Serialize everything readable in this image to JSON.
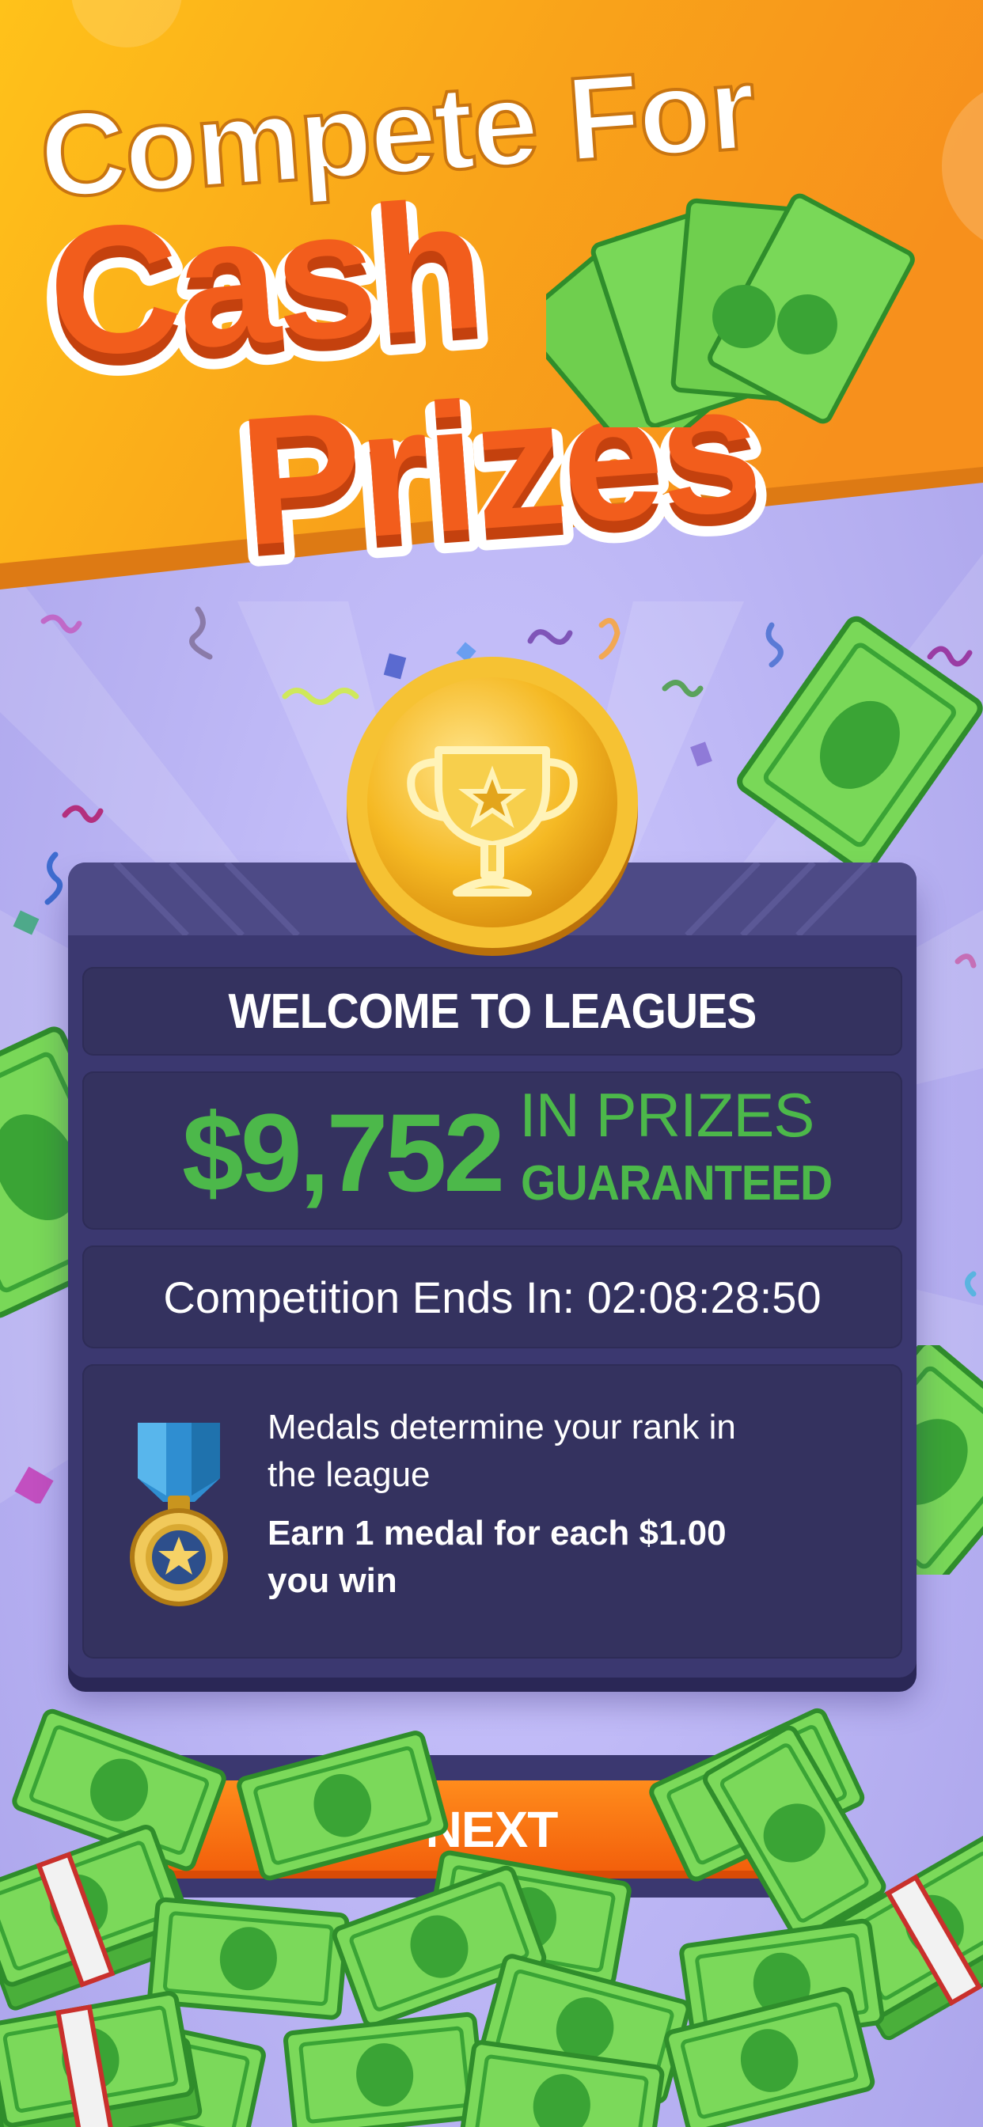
{
  "headline": {
    "line1": "Compete For",
    "line2": "Cash",
    "line3": "Prizes"
  },
  "card": {
    "title": "WELCOME TO LEAGUES",
    "prize_amount": "$9,752",
    "prize_label": "IN PRIZES",
    "prize_note": "GUARANTEED",
    "countdown": "Competition Ends In: 02:08:28:50",
    "medal_line1": "Medals determine your rank in",
    "medal_line2": "the league",
    "medal_rule_line1": "Earn 1 medal for each $1.00",
    "medal_rule_line2": "you win"
  },
  "next_button": {
    "label": "NEXT"
  },
  "icons": {
    "coin": "trophy-coin-icon",
    "medal": "star-medal-icon",
    "cash": "cash-bills-icon"
  },
  "colors": {
    "banner_orange": "#f7941d",
    "headline_orange": "#f4581b",
    "card_bg": "#3b3870",
    "prize_green": "#4cb84a",
    "button_orange": "#f56a0f",
    "background_lavender": "#bdb7f6"
  }
}
